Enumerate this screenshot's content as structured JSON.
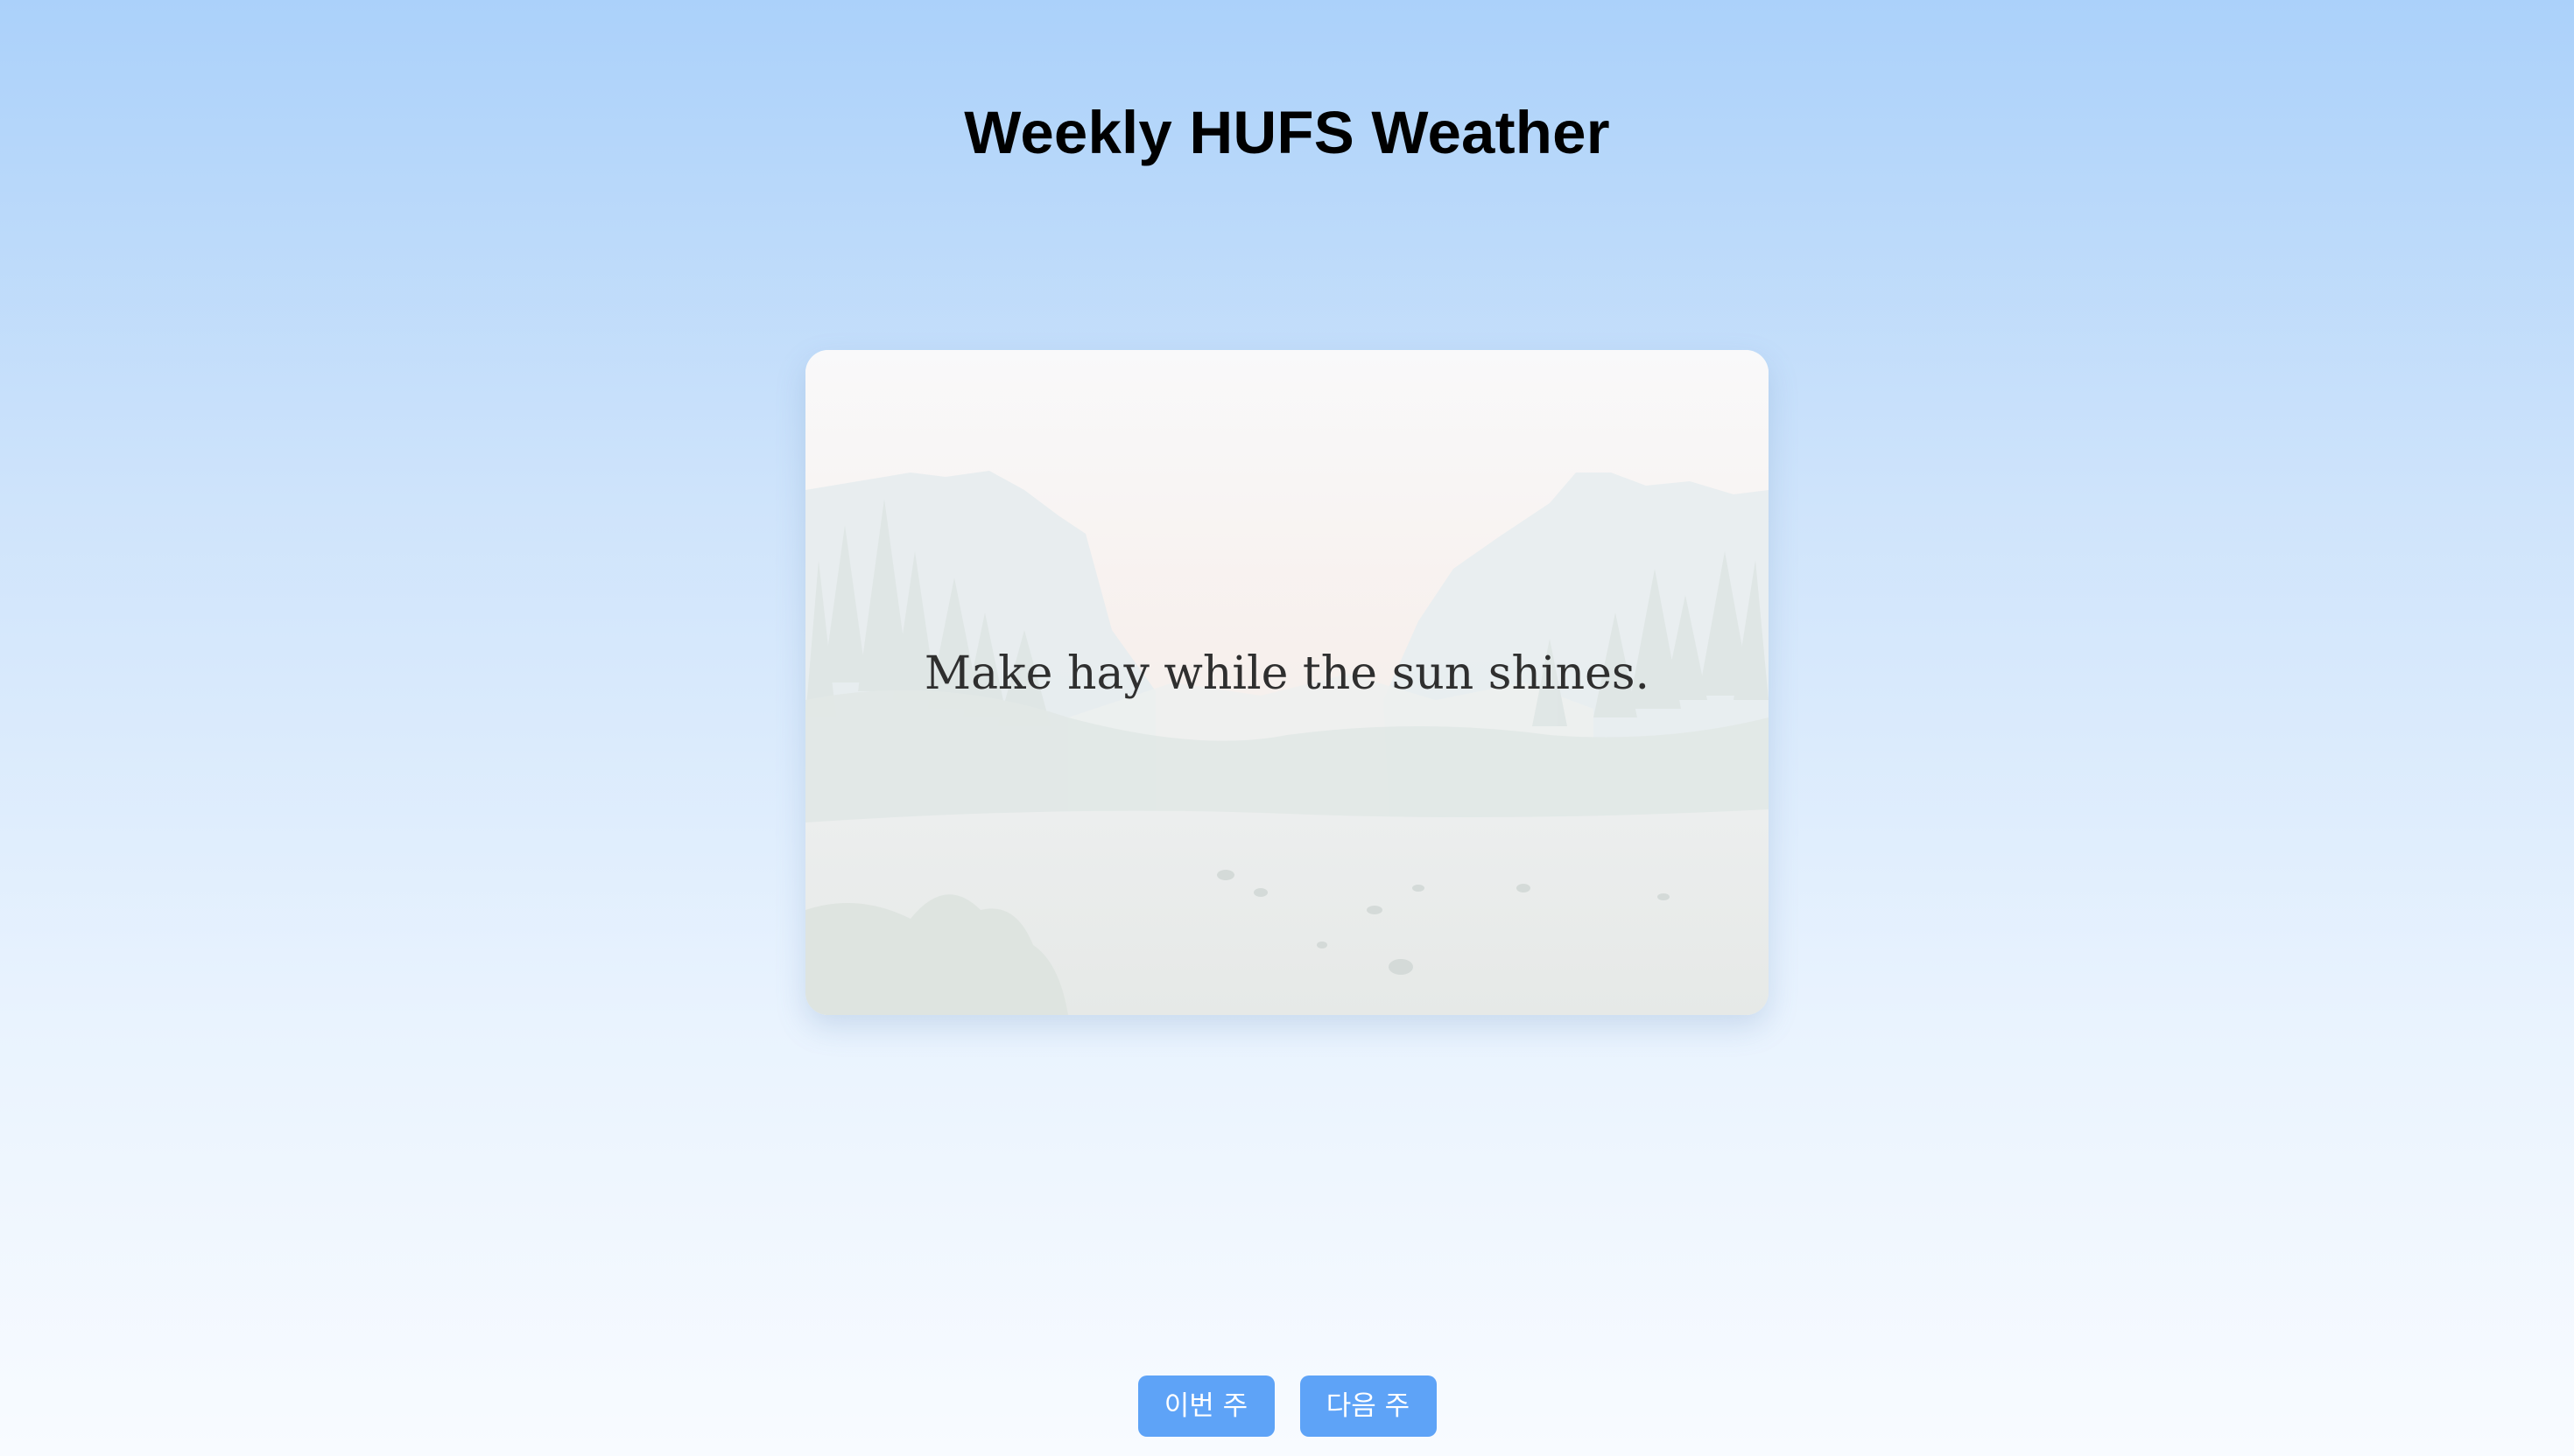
{
  "header": {
    "title": "Weekly HUFS Weather"
  },
  "card": {
    "quote": "Make hay while the sun shines.",
    "background_image": "misty-mountain-valley-river"
  },
  "buttons": {
    "this_week_label": "이번 주",
    "next_week_label": "다음 주"
  },
  "colors": {
    "accent": "#5ea3f7",
    "background_top": "#abd1fa",
    "background_bottom": "#f8fbff",
    "title": "#000000",
    "quote_text": "#2f2f2f"
  }
}
